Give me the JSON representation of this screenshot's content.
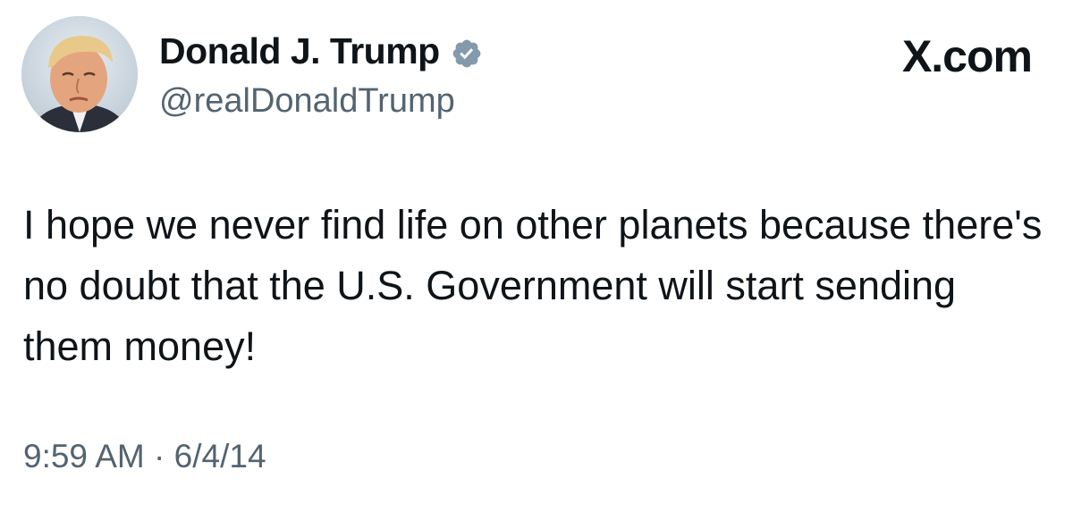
{
  "author": {
    "display_name": "Donald J. Trump",
    "handle": "@realDonaldTrump",
    "verified": true,
    "avatar_icon": "profile-photo-avatar",
    "verified_icon": "verified-badge-icon"
  },
  "brand": {
    "label": "X.com"
  },
  "tweet": {
    "text": "I hope we never find life on other planets because there's no doubt that the U.S. Government will start sending them money!",
    "time": "9:59 AM",
    "separator": "·",
    "date": "6/4/14"
  },
  "colors": {
    "text_primary": "#0f1419",
    "text_secondary": "#536471",
    "verified_badge": "#829aab",
    "background": "#ffffff"
  }
}
